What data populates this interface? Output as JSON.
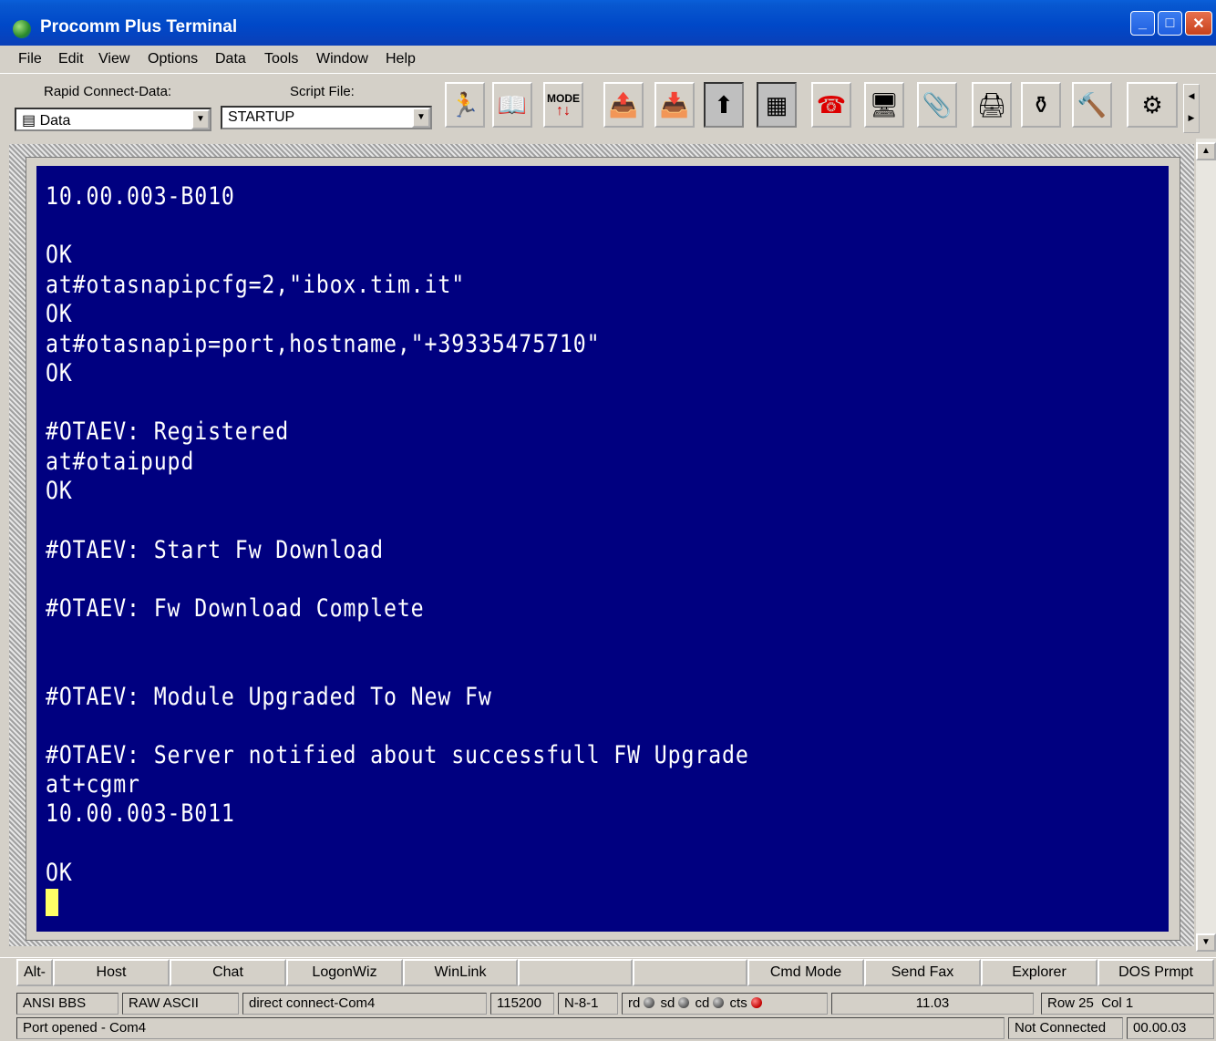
{
  "window": {
    "title": "Procomm Plus Terminal"
  },
  "menu": [
    "File",
    "Edit",
    "View",
    "Options",
    "Data",
    "Tools",
    "Window",
    "Help"
  ],
  "toolbar": {
    "rapid_connect_label": "Rapid Connect-Data:",
    "rapid_connect_value": "Data",
    "script_label": "Script File:",
    "script_value": "STARTUP",
    "mode_label": "MODE",
    "buttons": [
      "run-script-icon",
      "phonebook-icon",
      "mode-icon",
      "upload-icon",
      "download-icon",
      "capture-icon",
      "terminal-icon",
      "phone-icon",
      "monitor-icon",
      "clip-icon",
      "printer-icon",
      "sieve-icon",
      "tools-icon",
      "options-icon"
    ]
  },
  "terminal": {
    "lines": [
      "10.00.003-B010",
      "",
      "OK",
      "at#otasnapipcfg=2,\"ibox.tim.it\"",
      "OK",
      "at#otasnapip=port,hostname,\"+39335475710\"",
      "OK",
      "",
      "#OTAEV: Registered",
      "at#otaipupd",
      "OK",
      "",
      "#OTAEV: Start Fw Download",
      "",
      "#OTAEV: Fw Download Complete",
      "",
      "",
      "#OTAEV: Module Upgraded To New Fw",
      "",
      "#OTAEV: Server notified about successfull FW Upgrade",
      "at+cgmr",
      "10.00.003-B011",
      "",
      "OK"
    ]
  },
  "action_bar": [
    "Alt-",
    "Host",
    "Chat",
    "LogonWiz",
    "WinLink",
    "",
    "",
    "Cmd Mode",
    "Send Fax",
    "Explorer",
    "DOS Prmpt"
  ],
  "status1": {
    "emulation": "ANSI BBS",
    "transfer": "RAW ASCII",
    "connection": "direct connect-Com4",
    "baud": "115200",
    "params": "N-8-1",
    "rd": "rd",
    "sd": "sd",
    "cd": "cd",
    "cts": "cts",
    "time": "11.03",
    "row": "Row 25",
    "col": "Col 1"
  },
  "status2": {
    "message": "Port opened - Com4",
    "state": "Not Connected",
    "elapsed": "00.00.03"
  }
}
